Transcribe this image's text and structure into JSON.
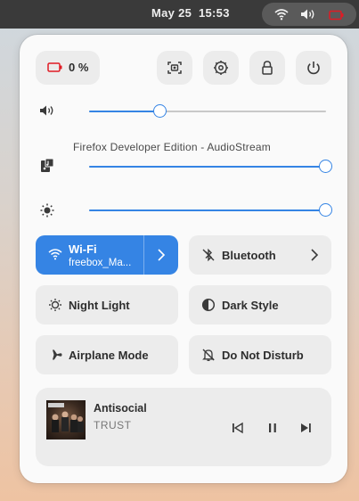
{
  "topbar": {
    "clock": "May 25  15:53",
    "indicators": [
      "wifi-icon",
      "volume-icon",
      "battery-icon"
    ]
  },
  "quick_settings": {
    "battery": {
      "icon": "battery-low-icon",
      "label": "0 %",
      "accent": "#e01b24"
    },
    "actions": [
      "screenshot-icon",
      "settings-icon",
      "lock-icon",
      "power-icon"
    ],
    "volume": {
      "icon": "volume-icon",
      "level": 0.3
    },
    "app_stream": {
      "icon": "app-audio-icon",
      "label": "Firefox Developer Edition - AudioStream",
      "level": 1.0
    },
    "brightness": {
      "icon": "brightness-icon",
      "level": 1.0
    },
    "tiles": {
      "wifi": {
        "label": "Wi-Fi",
        "subtitle": "freebox_Ma...",
        "active": true
      },
      "bluetooth": {
        "label": "Bluetooth",
        "active": false
      },
      "night_light": {
        "label": "Night Light",
        "active": false
      },
      "dark_style": {
        "label": "Dark Style",
        "active": false
      },
      "airplane_mode": {
        "label": "Airplane Mode",
        "active": false
      },
      "do_not_disturb": {
        "label": "Do Not Disturb",
        "active": false
      }
    },
    "media": {
      "title": "Antisocial",
      "artist": "TRUST",
      "state": "playing"
    },
    "accent_color": "#3584e4"
  }
}
